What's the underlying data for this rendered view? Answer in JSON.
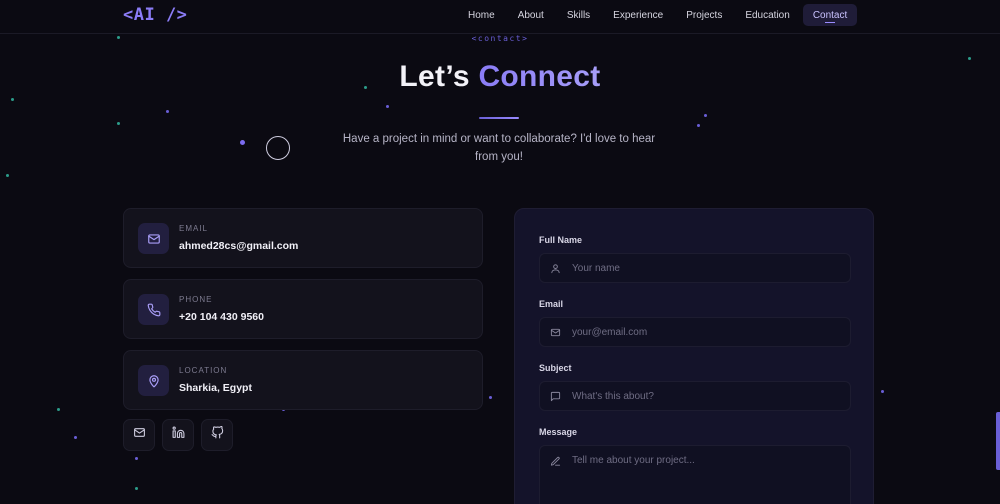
{
  "nav": {
    "logo": "<AI />",
    "links": [
      "Home",
      "About",
      "Skills",
      "Experience",
      "Projects",
      "Education",
      "Contact"
    ],
    "active": "Contact"
  },
  "header": {
    "eyebrow": "<contact>",
    "title_plain": "Let’s ",
    "title_accent": "Connect",
    "subtitle": "Have a project in mind or want to collaborate? I'd love to hear from you!"
  },
  "contact_info": [
    {
      "label": "EMAIL",
      "value": "ahmed28cs@gmail.com",
      "icon": "mail-icon"
    },
    {
      "label": "PHONE",
      "value": "+20 104 430 9560",
      "icon": "phone-icon"
    },
    {
      "label": "LOCATION",
      "value": "Sharkia, Egypt",
      "icon": "map-pin-icon"
    }
  ],
  "socials": [
    "mail-icon",
    "linkedin-icon",
    "github-icon"
  ],
  "form": {
    "name_label": "Full Name",
    "name_placeholder": "Your name",
    "email_label": "Email",
    "email_placeholder": "your@email.com",
    "subject_label": "Subject",
    "subject_placeholder": "What's this about?",
    "message_label": "Message",
    "message_placeholder": "Tell me about your project..."
  },
  "colors": {
    "background": "#0b0a12",
    "accent": "#8b7cf6",
    "card": "#13121c",
    "form_panel": "#14132a"
  }
}
